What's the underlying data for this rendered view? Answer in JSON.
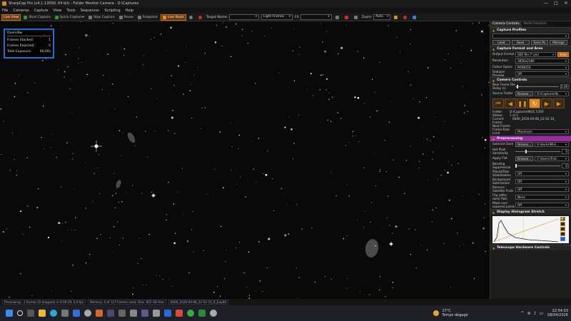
{
  "titlebar": {
    "title": "SharpCap Pro (v4.1.13000, 64 bit) - Folder Monitor Camera - D:\\Captures",
    "minimize": "—",
    "maximize": "□",
    "close": "✕"
  },
  "menu": [
    "File",
    "Cameras",
    "Capture",
    "View",
    "Tools",
    "Sequencer",
    "Scripting",
    "Help"
  ],
  "toolbar": {
    "live_view": "Live View",
    "start_capture": "Start Capture",
    "quick_capture": "Quick Capture",
    "stop_capture": "Stop Capture",
    "pause": "Pause",
    "snapshot": "Snapshot",
    "live_stack": "Live Stack",
    "target_name_label": "Target Name:",
    "target_name_value": "",
    "frame_type": "Light Frames",
    "fx_label": "FX",
    "fx_value": "",
    "zoom_label": "Zoom:",
    "zoom_value": "Auto"
  },
  "overview": {
    "title": "Overview",
    "frames_stacked_label": "Frames Stacked:",
    "frames_stacked_value": "1",
    "frames_rejected_label": "Frames Rejected:",
    "frames_rejected_value": "0",
    "total_exposure_label": "Total Exposure:",
    "total_exposure_value": "00,00s"
  },
  "panel": {
    "tab_camera_controls": "Camera Controls",
    "tab_multi_columns": "Multi Columns",
    "capture_profiles": {
      "title": "Capture Profiles",
      "load": "Load",
      "save": "Save",
      "save_as": "Save As",
      "manage": "Manage"
    },
    "capture_format": {
      "title": "Capture Format and Area",
      "output_format_label": "Output Format",
      "output_format_value": "SER file (*.ser)",
      "auto": "Auto",
      "resolution_label": "Resolution",
      "resolution_value": "3856x2180",
      "colour_space_label": "Colour Space",
      "colour_space_value": "MONO16",
      "debayer_label": "Debayer Preview",
      "debayer_value": "Off"
    },
    "camera_controls": {
      "title": "Camera Controls",
      "new_frame_label": "New Frame File Delay (s)",
      "new_frame_value": "5.00",
      "source_folder_label": "Source Folder",
      "browse": "Browse...",
      "source_folder_value": "D:\\Captures\\N...",
      "folder_label": "Folder:",
      "folder_value": "D:\\Captures\\NGC 5350",
      "status_label": "Status:",
      "status_value": "1 of 1",
      "current_frame_label": "Current Frame:",
      "current_frame_value": "0000_2026-04-08_22-52-10_",
      "next_frame_label": "Next Frame:",
      "next_frame_value": "",
      "frame_rate_label": "Frame Rate Limit",
      "frame_rate_value": "Maximum"
    },
    "preprocessing": {
      "title": "Preprocessing",
      "subtract_dark_label": "Subtract Dark",
      "subtract_dark_browse": "Browse...",
      "subtract_dark_value": "E:\\darks\\Mini...",
      "hot_pixel_label": "Hot Pixel Sensitivity",
      "hot_pixel_value": "0",
      "apply_flat_label": "Apply Flat",
      "apply_flat_browse": "Browse...",
      "apply_flat_value": "C:\\Users\\Trist...",
      "banding_label": "Banding Suppression",
      "banding_value": "0",
      "planet_label": "Planet/Disk Stabilization",
      "planet_value": "Off",
      "background_label": "Background Subtraction",
      "background_value": "Off",
      "satellite_label": "Remove Satellite Trails",
      "satellite_value": "Off",
      "flip_label": "Flip (after dark/ flat)",
      "flip_value": "None",
      "mask_label": "Mask over exposed pixels",
      "mask_value": "Off"
    },
    "histogram": {
      "title": "Display Histogram Stretch"
    },
    "telescope": {
      "title": "Telescope Hardware Controls"
    }
  },
  "statusbar": {
    "previewing": "Previewing : 1 frames (0 dropped) in 0:00:29, 0.0 fps",
    "memory": "Memory: 4 of 127 frames used, Disk: 855 GB free",
    "file": "0000_2026-04-08_22-52-10_R_Exp60"
  },
  "taskbar": {
    "temperature": "17°C",
    "weather": "Temps dégagé",
    "time": "22:54:03",
    "date": "08/04/2026"
  }
}
